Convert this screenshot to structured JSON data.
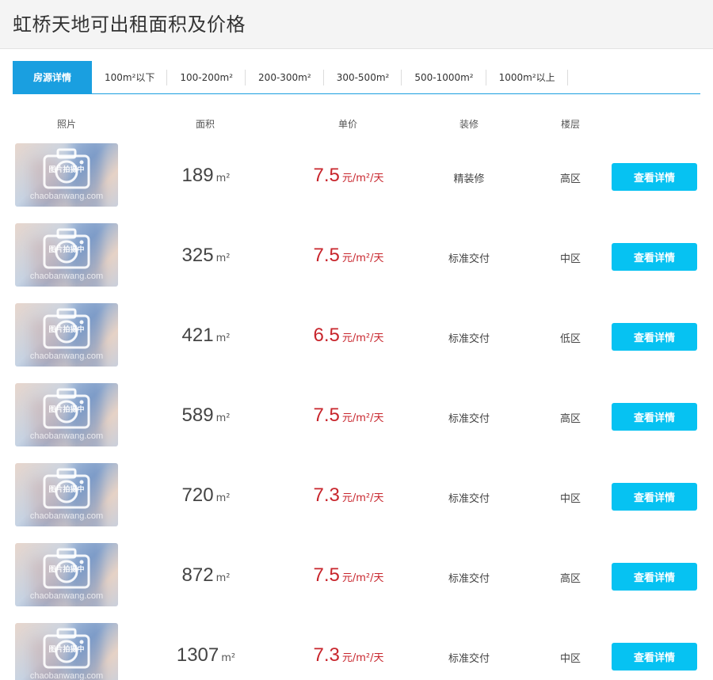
{
  "header": {
    "title": "虹桥天地可出租面积及价格"
  },
  "tabs": [
    {
      "label": "房源详情",
      "active": true
    },
    {
      "label": "100m²以下"
    },
    {
      "label": "100-200m²"
    },
    {
      "label": "200-300m²"
    },
    {
      "label": "300-500m²"
    },
    {
      "label": "500-1000m²"
    },
    {
      "label": "1000m²以上"
    }
  ],
  "columns": {
    "photo": "照片",
    "area": "面积",
    "price": "单价",
    "decoration": "装修",
    "floor": "楼层"
  },
  "photo_placeholder": {
    "label": "图片拍摄中",
    "watermark": "chaobanwang.com"
  },
  "area_unit": "m²",
  "price_unit": "元/m²/天",
  "button_label": "查看详情",
  "listings": [
    {
      "area": "189",
      "price": "7.5",
      "decoration": "精装修",
      "floor": "高区"
    },
    {
      "area": "325",
      "price": "7.5",
      "decoration": "标准交付",
      "floor": "中区"
    },
    {
      "area": "421",
      "price": "6.5",
      "decoration": "标准交付",
      "floor": "低区"
    },
    {
      "area": "589",
      "price": "7.5",
      "decoration": "标准交付",
      "floor": "高区"
    },
    {
      "area": "720",
      "price": "7.3",
      "decoration": "标准交付",
      "floor": "中区"
    },
    {
      "area": "872",
      "price": "7.5",
      "decoration": "标准交付",
      "floor": "高区"
    },
    {
      "area": "1307",
      "price": "7.3",
      "decoration": "标准交付",
      "floor": "中区"
    }
  ],
  "colors": {
    "accent_blue": "#1a9fe0",
    "button_blue": "#06c2f2",
    "price_red": "#c8252c"
  }
}
